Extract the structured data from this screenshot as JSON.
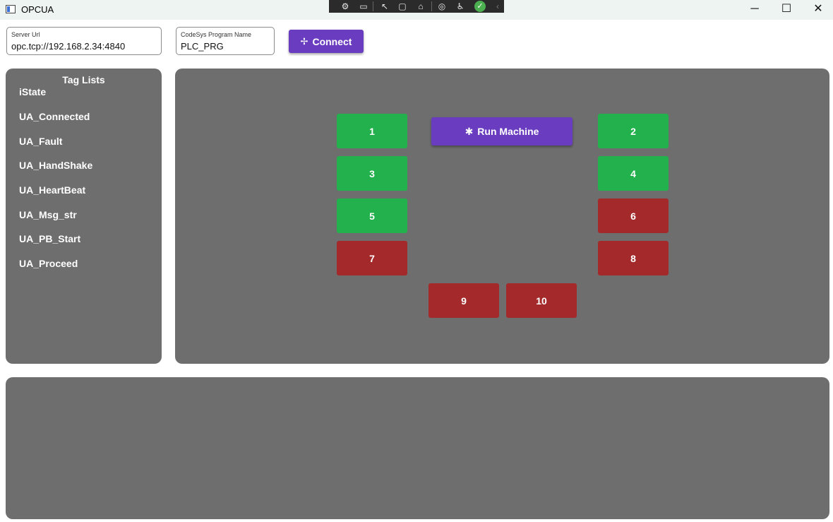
{
  "window": {
    "title": "OPCUA"
  },
  "window_controls": {
    "minimize": "─",
    "maximize": "☐",
    "close": "✕"
  },
  "debug_toolbar": {
    "icons": [
      "⚙",
      "▭",
      "↖",
      "▢",
      "⌂",
      "◎",
      "♿"
    ],
    "status": "✓",
    "collapse": "‹"
  },
  "server": {
    "label": "Server Url",
    "value": "opc.tcp://192.168.2.34:4840"
  },
  "program": {
    "label": "CodeSys Program Name",
    "value": "PLC_PRG"
  },
  "connect": {
    "label": "Connect",
    "icon": "✢"
  },
  "tag_list": {
    "title": "Tag Lists",
    "items": [
      "iState",
      "UA_Connected",
      "UA_Fault",
      "UA_HandShake",
      "UA_HeartBeat",
      "UA_Msg_str",
      "UA_PB_Start",
      "UA_Proceed"
    ]
  },
  "run_machine": {
    "label": "Run Machine",
    "icon": "✱"
  },
  "indicators": [
    {
      "label": "1",
      "status": "green"
    },
    {
      "label": "2",
      "status": "green"
    },
    {
      "label": "3",
      "status": "green"
    },
    {
      "label": "4",
      "status": "green"
    },
    {
      "label": "5",
      "status": "green"
    },
    {
      "label": "6",
      "status": "red"
    },
    {
      "label": "7",
      "status": "red"
    },
    {
      "label": "8",
      "status": "red"
    },
    {
      "label": "9",
      "status": "red"
    },
    {
      "label": "10",
      "status": "red"
    }
  ],
  "colors": {
    "green": "#22b14c",
    "red": "#a4292b",
    "accent": "#6a3cc0",
    "panel": "#6e6e6e"
  }
}
